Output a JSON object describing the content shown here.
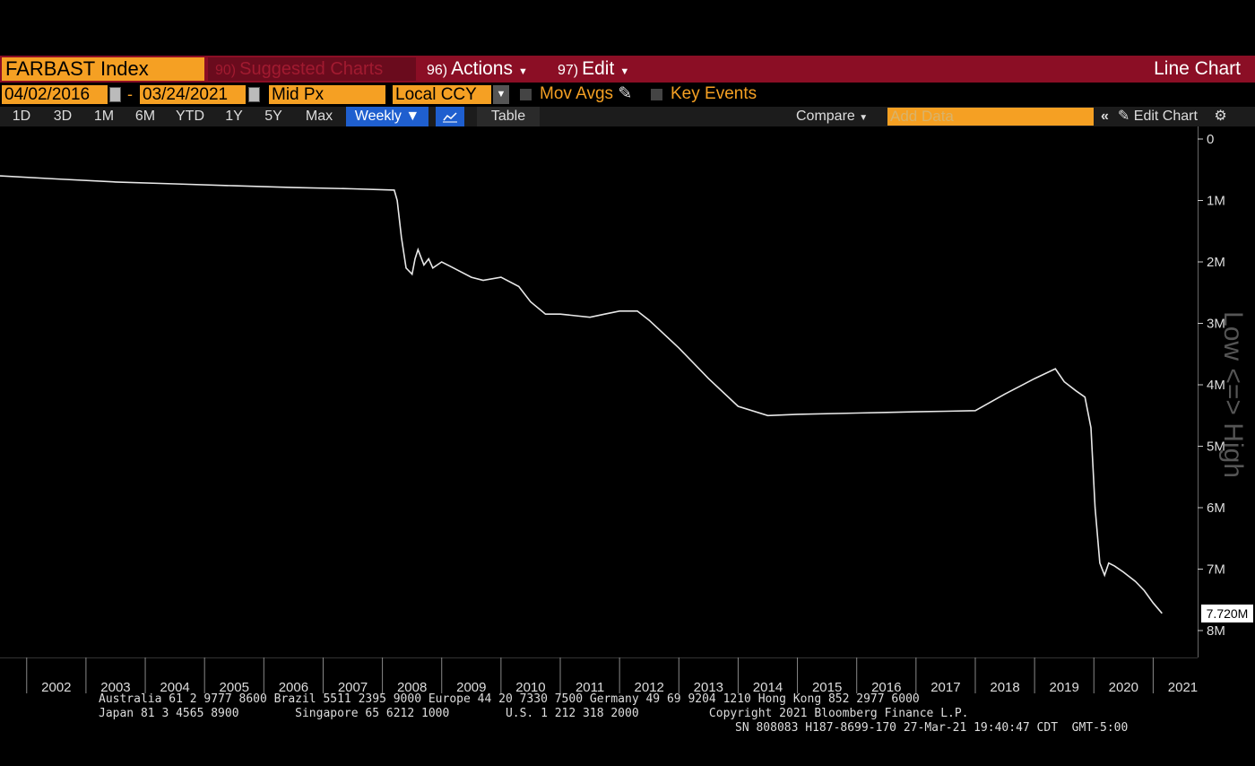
{
  "toolbar": {
    "ticker": "FARBAST Index",
    "suggested_num": "90)",
    "suggested_label": "Suggested Charts",
    "actions_num": "96)",
    "actions_label": "Actions",
    "edit_num": "97)",
    "edit_label": "Edit",
    "chart_type": "Line Chart"
  },
  "settings": {
    "start_date": "04/02/2016",
    "end_date": "03/24/2021",
    "price_field": "Mid Px",
    "currency": "Local CCY",
    "mov_avgs": "Mov Avgs",
    "key_events": "Key Events"
  },
  "ranges": [
    "1D",
    "3D",
    "1M",
    "6M",
    "YTD",
    "1Y",
    "5Y",
    "Max"
  ],
  "period": "Weekly ▼",
  "table_label": "Table",
  "compare_label": "Compare",
  "add_data_placeholder": "Add Data",
  "edit_chart_label": "Edit Chart",
  "axis_label": "Low <=> High",
  "last_value": "7.720M",
  "colors": {
    "brand_bar": "#8b0e25",
    "field": "#f5a023",
    "active": "#1f5fcf"
  },
  "chart_data": {
    "type": "line",
    "y_inverted": true,
    "ylim": [
      0,
      8000000
    ],
    "yticks": [
      "0",
      "1M",
      "2M",
      "3M",
      "4M",
      "5M",
      "6M",
      "7M",
      "8M"
    ],
    "ytick_values": [
      0,
      1000000,
      2000000,
      3000000,
      4000000,
      5000000,
      6000000,
      7000000,
      8000000
    ],
    "xlim": [
      2001.55,
      2021.75
    ],
    "xticks": [
      "2002",
      "2003",
      "2004",
      "2005",
      "2006",
      "2007",
      "2008",
      "2009",
      "2010",
      "2011",
      "2012",
      "2013",
      "2014",
      "2015",
      "2016",
      "2017",
      "2018",
      "2019",
      "2020",
      "2021"
    ],
    "series": [
      {
        "x": [
          2001.55,
          2002.5,
          2003.5,
          2004.5,
          2005.5,
          2006.5,
          2007.5,
          2008.2,
          2008.25,
          2008.32,
          2008.4,
          2008.5,
          2008.55,
          2008.6,
          2008.7,
          2008.78,
          2008.85,
          2009.0,
          2009.2,
          2009.5,
          2009.7,
          2010.0,
          2010.3,
          2010.5,
          2010.75,
          2011.0,
          2011.5,
          2011.75,
          2012.0,
          2012.3,
          2012.5,
          2013.0,
          2013.5,
          2014.0,
          2014.5,
          2015.0,
          2016.0,
          2016.5,
          2017.0,
          2017.5,
          2018.0,
          2018.5,
          2019.0,
          2019.35,
          2019.5,
          2019.7,
          2019.85,
          2019.95,
          2020.02,
          2020.1,
          2020.18,
          2020.25,
          2020.35,
          2020.5,
          2020.7,
          2020.85,
          2021.0,
          2021.15
        ],
        "y": [
          600000,
          650000,
          700000,
          730000,
          760000,
          790000,
          810000,
          830000,
          1000000,
          1600000,
          2100000,
          2200000,
          1950000,
          1800000,
          2050000,
          1950000,
          2100000,
          2000000,
          2100000,
          2250000,
          2300000,
          2250000,
          2400000,
          2650000,
          2850000,
          2850000,
          2900000,
          2850000,
          2800000,
          2800000,
          2950000,
          3400000,
          3900000,
          4350000,
          4500000,
          4480000,
          4460000,
          4450000,
          4440000,
          4430000,
          4420000,
          4150000,
          3900000,
          3740000,
          3950000,
          4100000,
          4200000,
          4700000,
          6000000,
          6900000,
          7100000,
          6900000,
          6950000,
          7050000,
          7200000,
          7350000,
          7550000,
          7720000
        ]
      }
    ]
  },
  "footer": {
    "line1": "Australia 61 2 9777 8600 Brazil 5511 2395 9000 Europe 44 20 7330 7500 Germany 49 69 9204 1210 Hong Kong 852 2977 6000",
    "line2": "Japan 81 3 4565 8900        Singapore 65 6212 1000        U.S. 1 212 318 2000          Copyright 2021 Bloomberg Finance L.P.",
    "line3": "SN 808083 H187-8699-170 27-Mar-21 19:40:47 CDT  GMT-5:00"
  }
}
